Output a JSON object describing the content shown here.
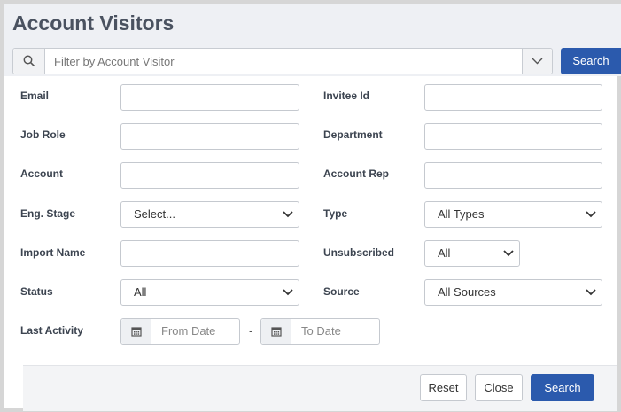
{
  "header": {
    "title": "Account Visitors",
    "filter_placeholder": "Filter by Account Visitor",
    "search_label": "Search"
  },
  "form": {
    "email_label": "Email",
    "invitee_id_label": "Invitee Id",
    "job_role_label": "Job Role",
    "department_label": "Department",
    "account_label": "Account",
    "account_rep_label": "Account Rep",
    "eng_stage_label": "Eng. Stage",
    "eng_stage_value": "Select...",
    "type_label": "Type",
    "type_value": "All Types",
    "import_name_label": "Import Name",
    "unsubscribed_label": "Unsubscribed",
    "unsubscribed_value": "All",
    "status_label": "Status",
    "status_value": "All",
    "source_label": "Source",
    "source_value": "All Sources",
    "last_activity_label": "Last Activity",
    "from_date_placeholder": "From Date",
    "to_date_placeholder": "To Date",
    "date_separator": "-"
  },
  "footer": {
    "reset_label": "Reset",
    "close_label": "Close",
    "search_label": "Search"
  },
  "colors": {
    "primary": "#2b5aad",
    "header_bg": "#eef0f4"
  }
}
